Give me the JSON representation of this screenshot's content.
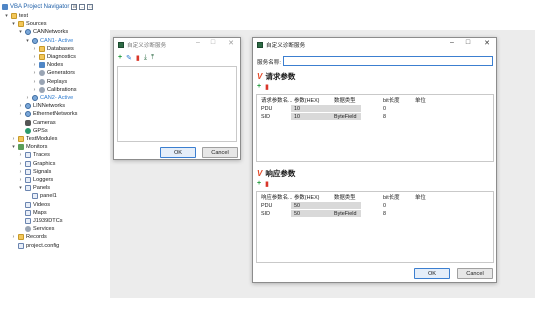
{
  "navigator": {
    "title": "VBA Project Navigator",
    "tree": [
      {
        "label": "test",
        "level": 0,
        "toggle": "▾",
        "icon": "folder"
      },
      {
        "label": "Sources",
        "level": 1,
        "toggle": "▾",
        "icon": "folder"
      },
      {
        "label": "CANNetworks",
        "level": 2,
        "toggle": "▾",
        "icon": "net"
      },
      {
        "label": "CAN1- Active",
        "level": 3,
        "toggle": "▾",
        "icon": "net",
        "active": true
      },
      {
        "label": "Databases",
        "level": 4,
        "toggle": "›",
        "icon": "folder"
      },
      {
        "label": "Diagnostics",
        "level": 4,
        "toggle": "›",
        "icon": "folder"
      },
      {
        "label": "Nodes",
        "level": 4,
        "toggle": "›",
        "icon": "node"
      },
      {
        "label": "Generators",
        "level": 4,
        "toggle": "›",
        "icon": "gear"
      },
      {
        "label": "Replays",
        "level": 4,
        "toggle": "›",
        "icon": "gear"
      },
      {
        "label": "Calibrations",
        "level": 4,
        "toggle": "›",
        "icon": "gear"
      },
      {
        "label": "CAN2- Active",
        "level": 3,
        "toggle": "›",
        "icon": "net",
        "active": true
      },
      {
        "label": "LINNetworks",
        "level": 2,
        "toggle": "›",
        "icon": "net"
      },
      {
        "label": "EthernetNetworks",
        "level": 2,
        "toggle": "›",
        "icon": "net"
      },
      {
        "label": "Cameras",
        "level": 2,
        "toggle": "",
        "icon": "cam"
      },
      {
        "label": "GPSs",
        "level": 2,
        "toggle": "",
        "icon": "gps"
      },
      {
        "label": "TestModules",
        "level": 1,
        "toggle": "›",
        "icon": "folder"
      },
      {
        "label": "Monitors",
        "level": 1,
        "toggle": "▾",
        "icon": "mon"
      },
      {
        "label": "Traces",
        "level": 2,
        "toggle": "›",
        "icon": "file"
      },
      {
        "label": "Graphics",
        "level": 2,
        "toggle": "›",
        "icon": "file"
      },
      {
        "label": "Signals",
        "level": 2,
        "toggle": "›",
        "icon": "file"
      },
      {
        "label": "Loggers",
        "level": 2,
        "toggle": "›",
        "icon": "file"
      },
      {
        "label": "Panels",
        "level": 2,
        "toggle": "▾",
        "icon": "file"
      },
      {
        "label": "panel1",
        "level": 3,
        "toggle": "",
        "icon": "file"
      },
      {
        "label": "Videos",
        "level": 2,
        "toggle": "",
        "icon": "file"
      },
      {
        "label": "Maps",
        "level": 2,
        "toggle": "",
        "icon": "file"
      },
      {
        "label": "J1939DTCs",
        "level": 2,
        "toggle": "",
        "icon": "file"
      },
      {
        "label": "Services",
        "level": 2,
        "toggle": "",
        "icon": "gear"
      },
      {
        "label": "Records",
        "level": 1,
        "toggle": "›",
        "icon": "folder"
      },
      {
        "label": "project.config",
        "level": 1,
        "toggle": "",
        "icon": "file"
      }
    ]
  },
  "dialog_small": {
    "title": "自定义诊断服务",
    "ok": "OK",
    "cancel": "Cancel"
  },
  "dialog_main": {
    "title": "自定义诊断服务",
    "service_name_label": "服务名称:",
    "service_name_value": "",
    "request_title": "请求参数",
    "response_title": "响应参数",
    "columns_request": [
      "请求参数名...",
      "参数(HEX)",
      "数据类型",
      "bit长度",
      "单位"
    ],
    "columns_response": [
      "响应参数名...",
      "参数(HEX)",
      "数据类型",
      "bit长度",
      "单位"
    ],
    "request_rows": [
      {
        "name": "PDU",
        "hex": "10",
        "type": "",
        "bits": "0",
        "unit": ""
      },
      {
        "name": "SID",
        "hex": "10",
        "type": "ByteField",
        "bits": "8",
        "unit": ""
      }
    ],
    "response_rows": [
      {
        "name": "PDU",
        "hex": "50",
        "type": "",
        "bits": "0",
        "unit": ""
      },
      {
        "name": "SID",
        "hex": "50",
        "type": "ByteField",
        "bits": "8",
        "unit": ""
      }
    ],
    "ok": "OK",
    "cancel": "Cancel"
  }
}
